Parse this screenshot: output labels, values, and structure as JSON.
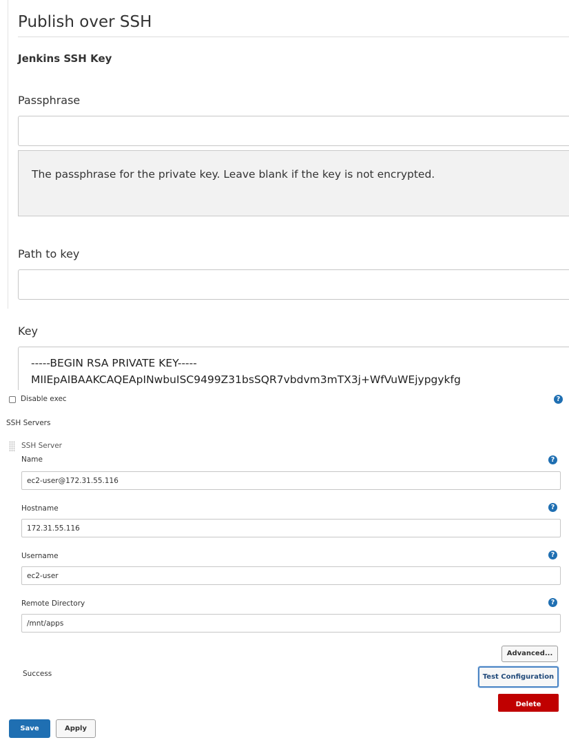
{
  "section": {
    "title": "Publish over SSH",
    "subheading": "Jenkins SSH Key"
  },
  "passphrase": {
    "label": "Passphrase",
    "value": "",
    "help": "The passphrase for the private key. Leave blank if the key is not encrypted."
  },
  "path_to_key": {
    "label": "Path to key",
    "value": ""
  },
  "key": {
    "label": "Key",
    "lines": [
      "-----BEGIN RSA PRIVATE KEY-----",
      "MIIEpAIBAAKCAQEApINwbuISC9499Z31bsSQR7vbdvm3mTX3j+WfVuWEjypgykfg"
    ]
  },
  "disable_exec": {
    "label": "Disable exec",
    "checked": false
  },
  "ssh_servers": {
    "label": "SSH Servers",
    "server": {
      "header": "SSH Server",
      "fields": {
        "name": {
          "label": "Name",
          "value": "ec2-user@172.31.55.116"
        },
        "hostname": {
          "label": "Hostname",
          "value": "172.31.55.116"
        },
        "username": {
          "label": "Username",
          "value": "ec2-user"
        },
        "remote_directory": {
          "label": "Remote Directory",
          "value": "/mnt/apps"
        }
      },
      "advanced_label": "Advanced...",
      "status_text": "Success",
      "test_label": "Test Configuration",
      "delete_label": "Delete"
    }
  },
  "help_icon_glyph": "?",
  "footer": {
    "save_label": "Save",
    "apply_label": "Apply"
  },
  "colors": {
    "primary": "#1f6fb2",
    "danger": "#c00000",
    "help_box_bg": "#f2f2f2"
  }
}
